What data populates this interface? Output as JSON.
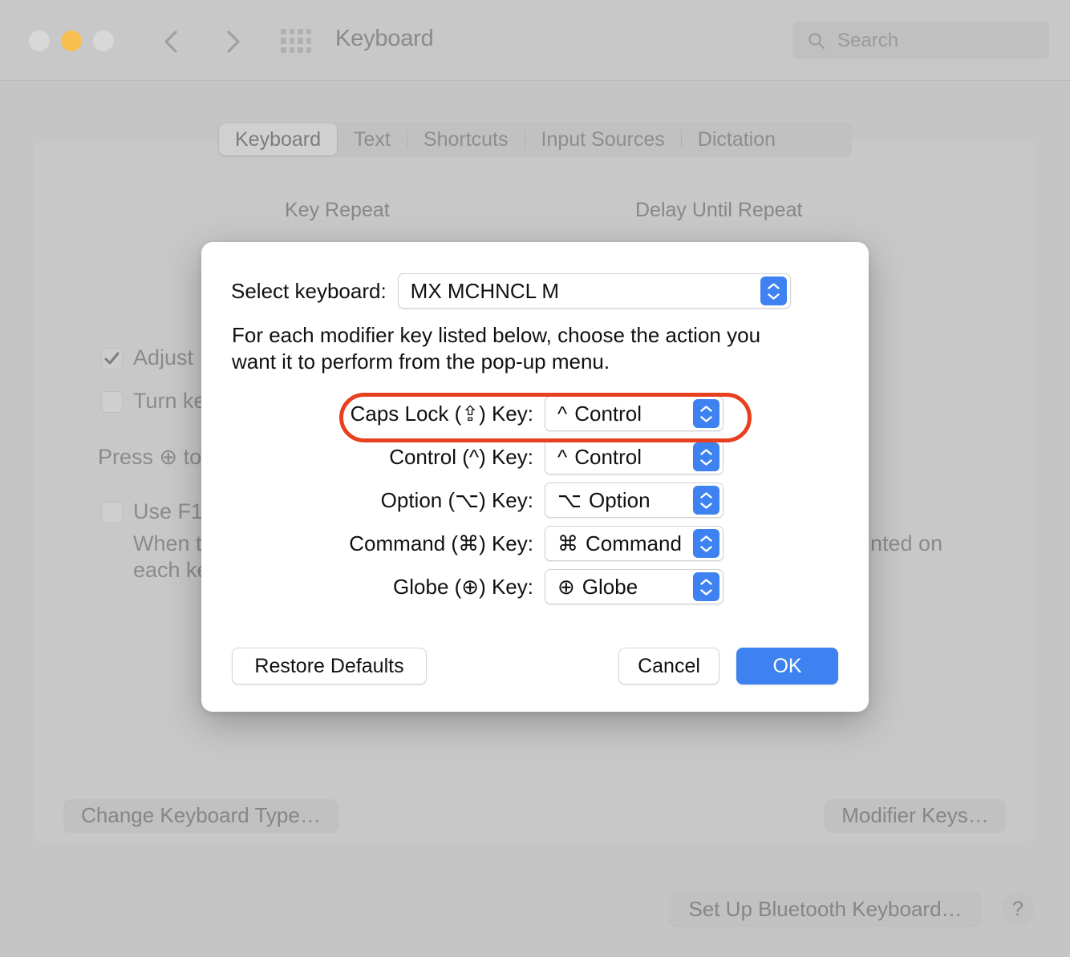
{
  "window": {
    "title": "Keyboard",
    "traffic_lights": [
      "close",
      "minimize",
      "zoom"
    ],
    "back_icon": "chevron-left-icon",
    "forward_icon": "chevron-right-icon",
    "grid_icon": "grid-apps-icon"
  },
  "search": {
    "placeholder": "Search",
    "icon": "search-icon"
  },
  "tabs": [
    {
      "label": "Keyboard",
      "active": true
    },
    {
      "label": "Text",
      "active": false
    },
    {
      "label": "Shortcuts",
      "active": false
    },
    {
      "label": "Input Sources",
      "active": false
    },
    {
      "label": "Dictation",
      "active": false
    }
  ],
  "background": {
    "column_headers": {
      "key_repeat": "Key Repeat",
      "delay_until_repeat": "Delay Until Repeat"
    },
    "options": [
      {
        "label": "Adjust ",
        "checked": true
      },
      {
        "label": "Turn ke",
        "checked": false
      }
    ],
    "press_globe_text": "Press ⊕ to",
    "fkey_option": {
      "label": "Use F1,",
      "checked": false
    },
    "fkey_note_line1": "When t",
    "fkey_note_line2": "each ke",
    "fkey_note_right": "nted on",
    "buttons": {
      "change_keyboard_type": "Change Keyboard Type…",
      "modifier_keys": "Modifier Keys…",
      "set_up_bluetooth": "Set Up Bluetooth Keyboard…",
      "help": "?"
    }
  },
  "dialog": {
    "select_keyboard_label": "Select keyboard:",
    "selected_keyboard": "MX MCHNCL M",
    "instruction": "For each modifier key listed below, choose the action you want it to perform from the pop-up menu.",
    "modifiers": [
      {
        "label": "Caps Lock (⇪) Key:",
        "glyph": "^",
        "value": "Control",
        "highlighted": true
      },
      {
        "label": "Control (^) Key:",
        "glyph": "^",
        "value": "Control",
        "highlighted": false
      },
      {
        "label": "Option (⌥) Key:",
        "glyph": "⌥",
        "value": "Option",
        "highlighted": false
      },
      {
        "label": "Command (⌘) Key:",
        "glyph": "⌘",
        "value": "Command",
        "highlighted": false
      },
      {
        "label": "Globe (⊕) Key:",
        "glyph": "⊕",
        "value": "Globe",
        "highlighted": false
      }
    ],
    "buttons": {
      "restore_defaults": "Restore Defaults",
      "cancel": "Cancel",
      "ok": "OK"
    }
  },
  "colors": {
    "accent_blue": "#3d82f0",
    "highlight_red": "#e8401f",
    "window_gray": "#c6c6c6",
    "dialog_white": "#ffffff",
    "amber_light": "#f6bf4f"
  }
}
